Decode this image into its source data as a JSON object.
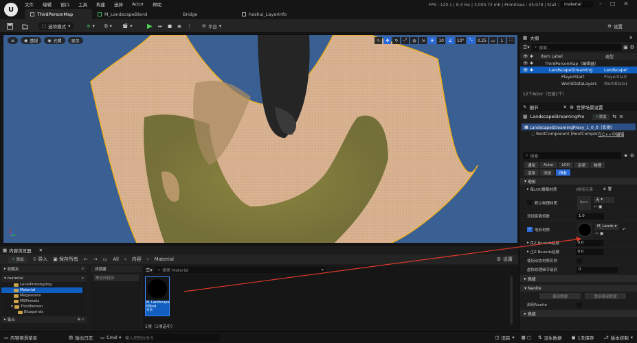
{
  "app": {
    "menu": [
      "文件",
      "编辑",
      "窗口",
      "工具",
      "构建",
      "选择",
      "Actor",
      "帮助"
    ],
    "tabs": [
      {
        "label": "ThirdPersonMap",
        "active": true
      },
      {
        "label": "M_LandscapeBlend",
        "active": false
      },
      {
        "label": "Bridge",
        "active": false
      },
      {
        "label": "heshui_LayerInfo",
        "active": false
      }
    ],
    "perf": "FPS : 120.1  |  8.3 ms  |  3,000.73 mb  |  Primitives : 45,979  |  Stall : 0",
    "top_search": "material"
  },
  "toolbar": {
    "mode": "选项模式",
    "platform": "平台",
    "settings": "设置"
  },
  "viewport": {
    "left_buttons": [
      "透视",
      "光照",
      "显示"
    ],
    "right_values": {
      "grid": "10",
      "angle": "10°",
      "scale": "0.25",
      "camera": "1"
    }
  },
  "outliner": {
    "title": "大纲",
    "search_placeholder": "搜索...",
    "col_label": "Item Label",
    "col_type": "类型",
    "rows": [
      {
        "label": "ThirdPersonMap（编辑器）",
        "type": "",
        "indent": 1,
        "selected": false
      },
      {
        "label": "LandscapeStreaming",
        "type": "LandscapeS",
        "indent": 3,
        "selected": true
      },
      {
        "label": "PlayerStart",
        "type": "PlayerStart",
        "indent": 3,
        "selected": false
      },
      {
        "label": "WorldDataLayers",
        "type": "WorldDataL",
        "indent": 3,
        "selected": false
      }
    ],
    "footer": "12个Actor（已选1个）"
  },
  "details": {
    "tab_details": "细节",
    "tab_world": "世界场景设置",
    "actor_name": "LandscapeStreamingPro",
    "add_label": "添加",
    "component_root": "LandscapeStreamingProxy_1_0_0（实例）",
    "component_child": "RootComponent (RootComponent0)",
    "component_link": "在C++中编辑",
    "search_placeholder": "搜索",
    "filters_row1": [
      "通用",
      "Actor",
      "LOD",
      "杂项",
      "物理"
    ],
    "filters_row2": [
      "渲染",
      "流送",
      "所有"
    ],
    "cat_landscape": "地形",
    "props": {
      "lod_material": "每LOD覆载材质",
      "lod_material_value": "0数组元素",
      "default_phys": "默认物理材质",
      "phys_value": "无",
      "phys_thumb": "None",
      "stream_dist": "流送距离倍数",
      "stream_dist_value": "1.0",
      "landscape_mat": "地形材质",
      "landscape_mat_value": "M_Lands",
      "neg_z": "负Z Bounds延展",
      "neg_z_value": "0.0",
      "pos_z": "正Z Bounds延展",
      "pos_z_value": "0.0",
      "dyn_mat": "使用动态材质实例",
      "lod_dist": "虚拟纹理细节级别",
      "lod_dist_value": "0"
    },
    "cat_advanced": "高级",
    "cat_nanite": "Nanite",
    "rebuild_data": "编译数据",
    "rebuild_again": "重新编译数据",
    "enable_nanite": "启用Nanite",
    "cat_advanced2": "高级"
  },
  "content_browser": {
    "title": "内容浏览器",
    "add": "添加",
    "import": "导入",
    "save_all": "保存所有",
    "breadcrumb": [
      "All",
      "内容",
      "Material"
    ],
    "settings": "设置",
    "favorites": "收藏夹",
    "root": "material",
    "tree": [
      "LevelPrototyping",
      "Material",
      "Megascans",
      "MSPresets",
      "ThirdPerson",
      "Blueprints"
    ],
    "collections": "集合",
    "filters_title": "滤镜器",
    "filters_item": "静态网格体",
    "search_placeholder": "搜索 Material",
    "asset_name_1": "M_Landscape",
    "asset_name_2": "Blend",
    "asset_type": "材质",
    "count": "1项（1项选中）"
  },
  "statusbar": {
    "drawer": "内容侧滑菜单",
    "log": "输出日志",
    "cmd": "Cmd",
    "cmd_placeholder": "输入控制台命令",
    "trace": "追踪",
    "derived": "派生数据",
    "unsaved": "1未保存",
    "source": "版本控制"
  },
  "colors": {
    "accent": "#0f5ec0",
    "selection_outline": "#f0b020",
    "viewport_bg": "#3a5f92",
    "landscape": "#d8b08c",
    "grass": "#7f7a3a",
    "arrow": "#e03a2a"
  }
}
